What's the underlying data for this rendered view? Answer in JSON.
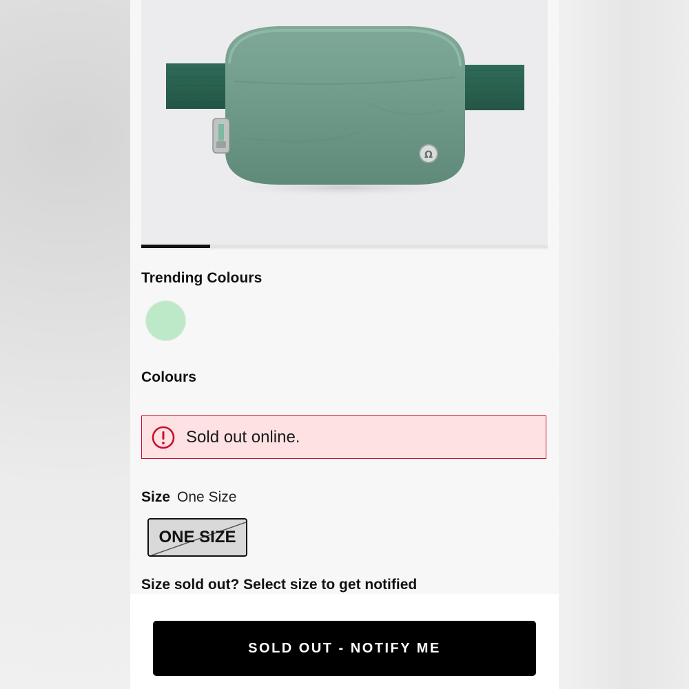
{
  "product": {
    "gallery": {
      "image_alt": "Sage green belt bag",
      "progress": 0.17
    },
    "trending": {
      "title": "Trending Colours",
      "swatch_color": "#bde9c8"
    },
    "colours": {
      "title": "Colours"
    },
    "alert": {
      "icon": "exclamation-circle-icon",
      "text": "Sold out online.",
      "accent_color": "#c8102e",
      "background_color": "#fde1e3"
    },
    "size": {
      "label": "Size",
      "selected": "One Size",
      "option": "ONE SIZE",
      "option_sold_out": true
    },
    "notify_help": "Size sold out? Select size to get notified",
    "cta": {
      "label": "SOLD OUT - NOTIFY ME"
    }
  }
}
